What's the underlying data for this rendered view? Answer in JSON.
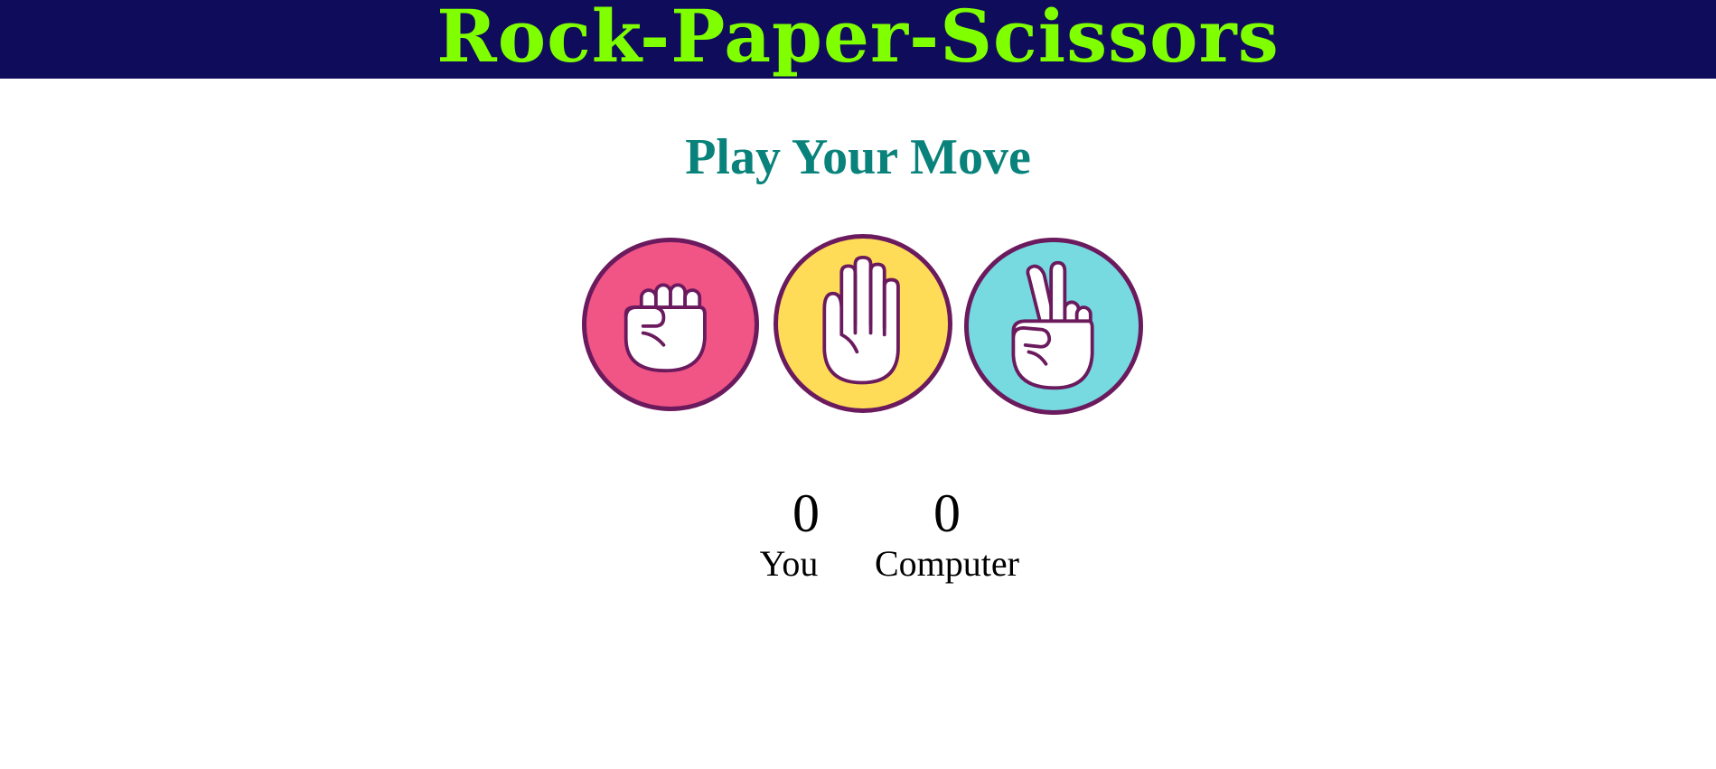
{
  "header": {
    "title": "Rock-Paper-Scissors",
    "background_color": "#0f0c5c",
    "title_color": "#7fff00"
  },
  "main": {
    "prompt": "Play Your Move",
    "prompt_color": "#08827a"
  },
  "choices": [
    {
      "name": "rock",
      "icon": "fist-icon",
      "color": "#f05586"
    },
    {
      "name": "paper",
      "icon": "open-hand-icon",
      "color": "#ffdc58"
    },
    {
      "name": "scissors",
      "icon": "victory-hand-icon",
      "color": "#76dae0"
    }
  ],
  "scoreboard": {
    "user_score": "0",
    "user_label": "You",
    "computer_score": "0",
    "computer_label": "Computer"
  }
}
